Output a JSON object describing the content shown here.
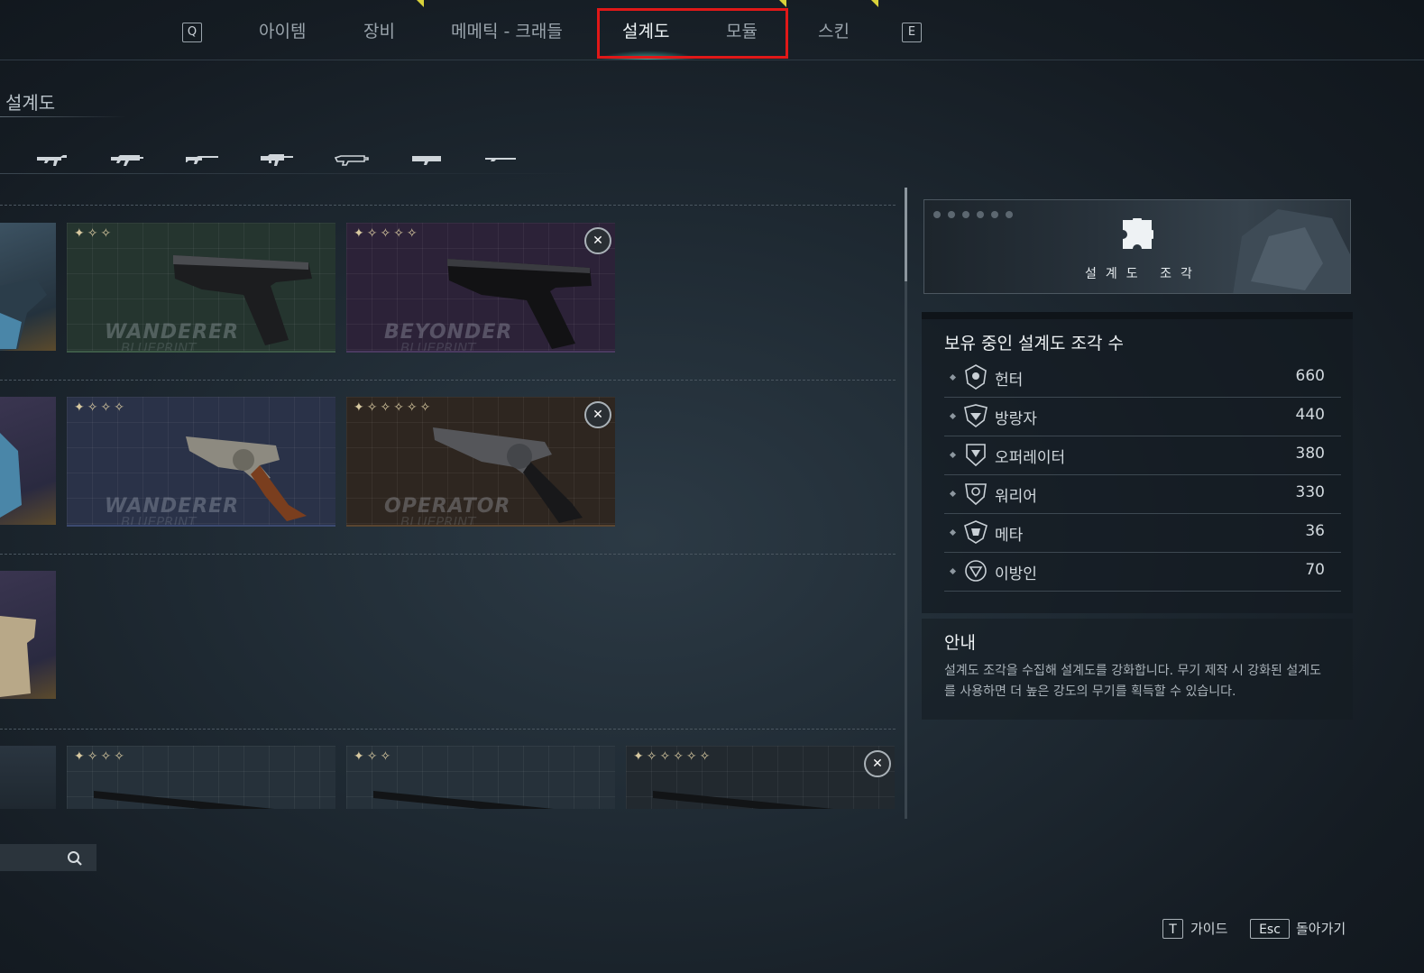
{
  "nav": {
    "key_left": "Q",
    "key_right": "E",
    "tabs": [
      {
        "label": "아이템"
      },
      {
        "label": "장비"
      },
      {
        "label": "메메틱 - 크래들"
      },
      {
        "label": "설계도"
      },
      {
        "label": "모듈"
      },
      {
        "label": "스킨"
      }
    ],
    "active_tab": "설계도"
  },
  "section": {
    "title": "설계도"
  },
  "weapon_filters": [
    "smg-icon",
    "assault-rifle-icon",
    "rifle-icon",
    "machine-gun-icon",
    "shotgun-icon",
    "launcher-icon",
    "sniper-rifle-icon"
  ],
  "blueprints": {
    "row1": [
      {
        "stars": "✦✧✧",
        "brand": "WANDERER",
        "sub": "BLUEPRINT"
      },
      {
        "stars": "✦✧✧✧✧",
        "brand": "BEYONDER",
        "sub": "BLUEPRINT"
      }
    ],
    "row2": [
      {
        "stars": "✦✧✧✧",
        "brand": "WANDERER",
        "sub": "BLUEPRINT"
      },
      {
        "stars": "✦✧✧✧✧✧",
        "brand": "OPERATOR",
        "sub": "BLUEPRINT"
      }
    ],
    "row4": [
      {
        "stars": "✦✧✧✧"
      },
      {
        "stars": "✦✧✧"
      },
      {
        "stars": "✦✧✧✧✧✧"
      }
    ]
  },
  "search": {
    "icon": "search-icon"
  },
  "fragment_banner": {
    "label": "설계도 조각",
    "icon": "puzzle-piece-icon"
  },
  "fragments": {
    "header": "보유 중인 설계도 조각 수",
    "items": [
      {
        "name": "헌터",
        "count": "660",
        "icon": "hunter-emblem-icon"
      },
      {
        "name": "방랑자",
        "count": "440",
        "icon": "wanderer-emblem-icon"
      },
      {
        "name": "오퍼레이터",
        "count": "380",
        "icon": "operator-emblem-icon"
      },
      {
        "name": "워리어",
        "count": "330",
        "icon": "warrior-emblem-icon"
      },
      {
        "name": "메타",
        "count": "36",
        "icon": "meta-emblem-icon"
      },
      {
        "name": "이방인",
        "count": "70",
        "icon": "stranger-emblem-icon"
      }
    ]
  },
  "guide": {
    "title": "안내",
    "text": "설계도 조각을 수집해 설계도를 강화합니다. 무기 제작 시 강화된 설계도를 사용하면 더 높은 강도의 무기를 획득할 수 있습니다."
  },
  "hints": {
    "guide_key": "T",
    "guide_label": "가이드",
    "back_key": "Esc",
    "back_label": "돌아가기"
  },
  "colors": {
    "accent_highlight": "#e01818",
    "active_glow": "#46dcc8",
    "tick_yellow": "#d9d23a"
  }
}
